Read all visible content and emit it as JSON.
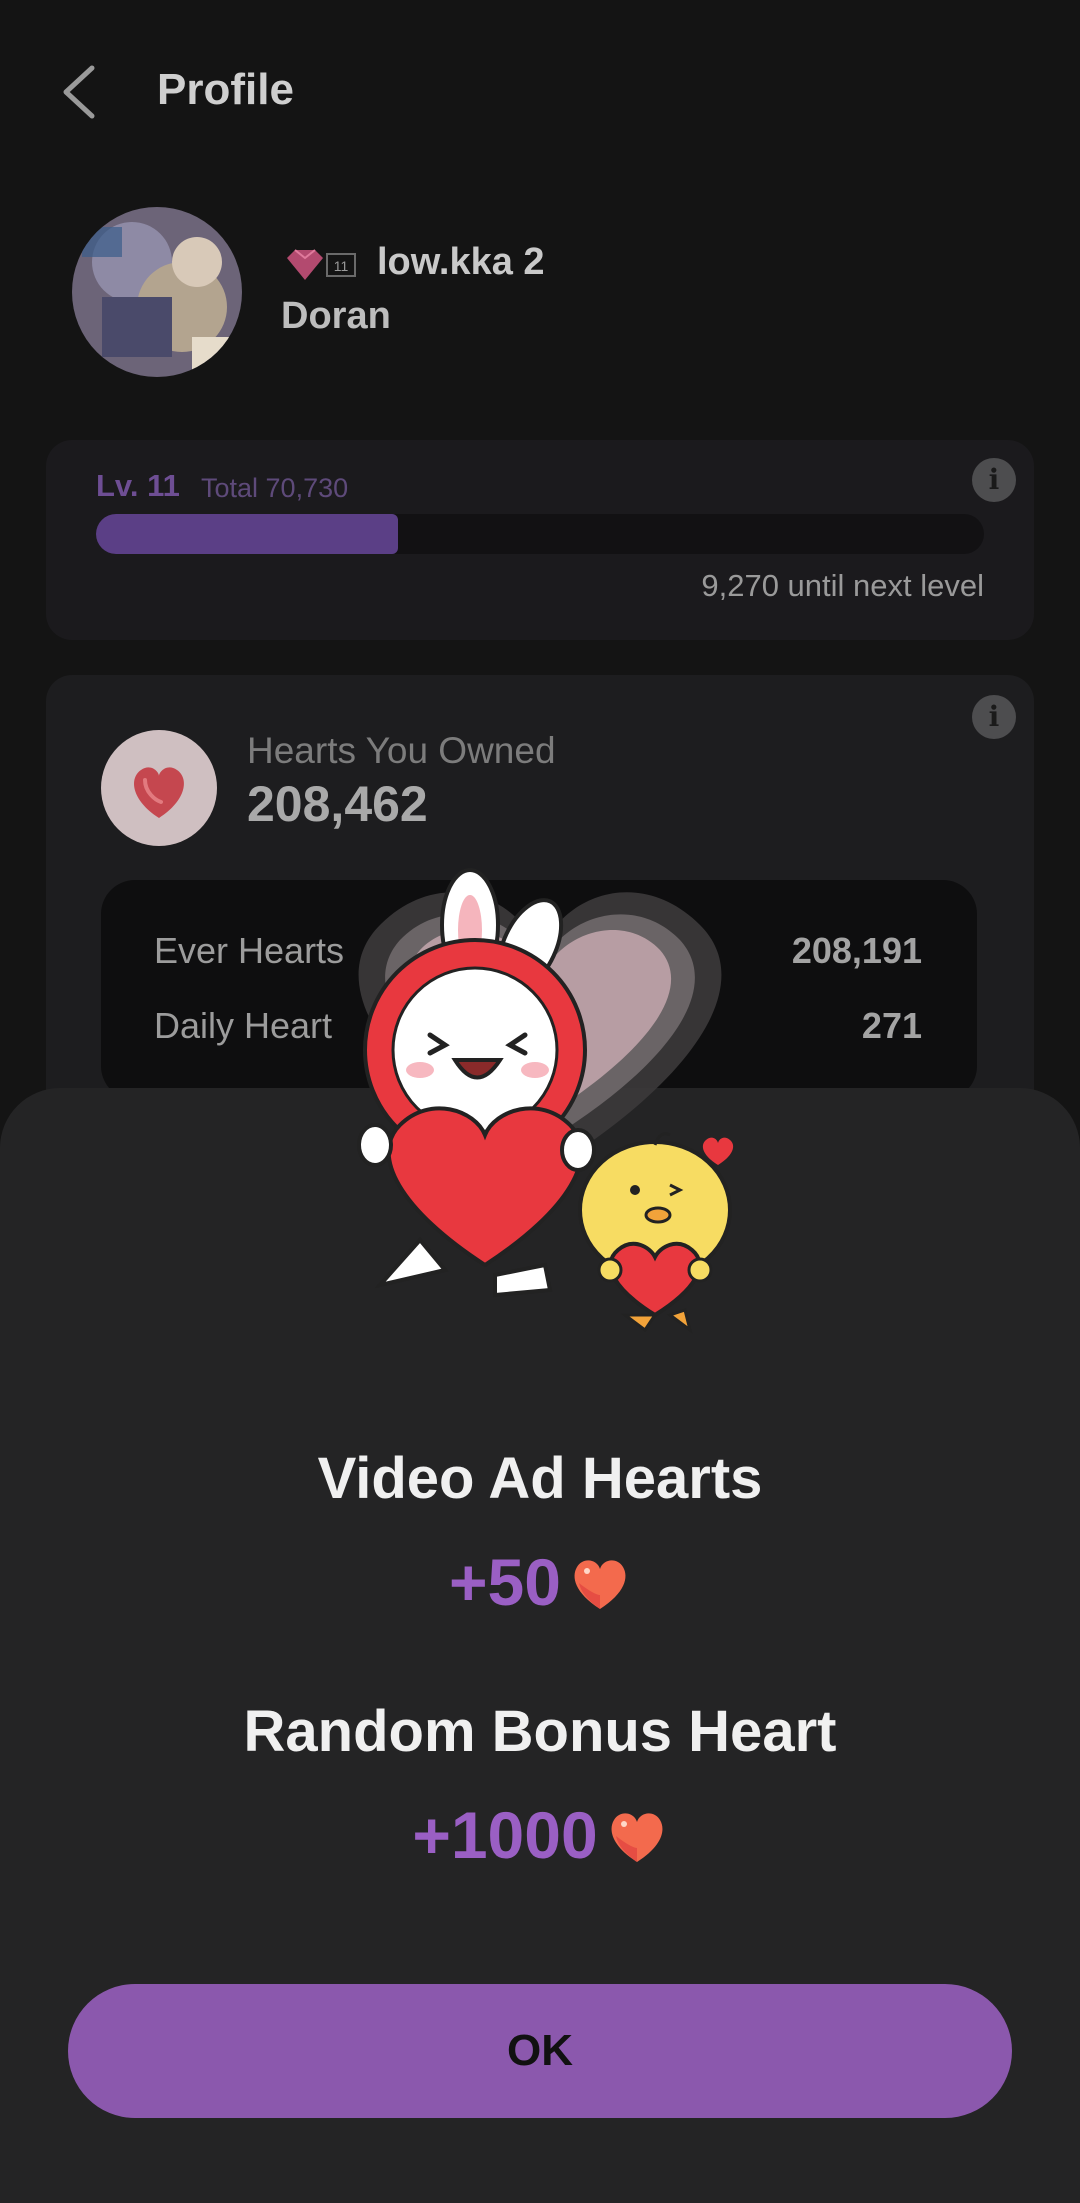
{
  "header": {
    "title": "Profile"
  },
  "profile": {
    "badge_level": "11",
    "username": "low.kka 2",
    "nickname": "Doran"
  },
  "level_card": {
    "level": "Lv. 11",
    "total": "Total 70,730",
    "progress_fraction": 0.34,
    "next_level_text": "9,270 until next level"
  },
  "hearts_card": {
    "owned_label": "Hearts You Owned",
    "owned_value": "208,462",
    "rows": [
      {
        "label": "Ever Hearts",
        "value": "208,191"
      },
      {
        "label": "Daily Heart",
        "value": "271"
      }
    ]
  },
  "popup": {
    "reward1_title": "Video Ad Hearts",
    "reward1_amount": "+50",
    "reward2_title": "Random Bonus Heart",
    "reward2_amount": "+1000",
    "ok_label": "OK"
  },
  "colors": {
    "accent": "#8b58ad",
    "amount": "#9a5fc4",
    "sheet": "#242425"
  }
}
